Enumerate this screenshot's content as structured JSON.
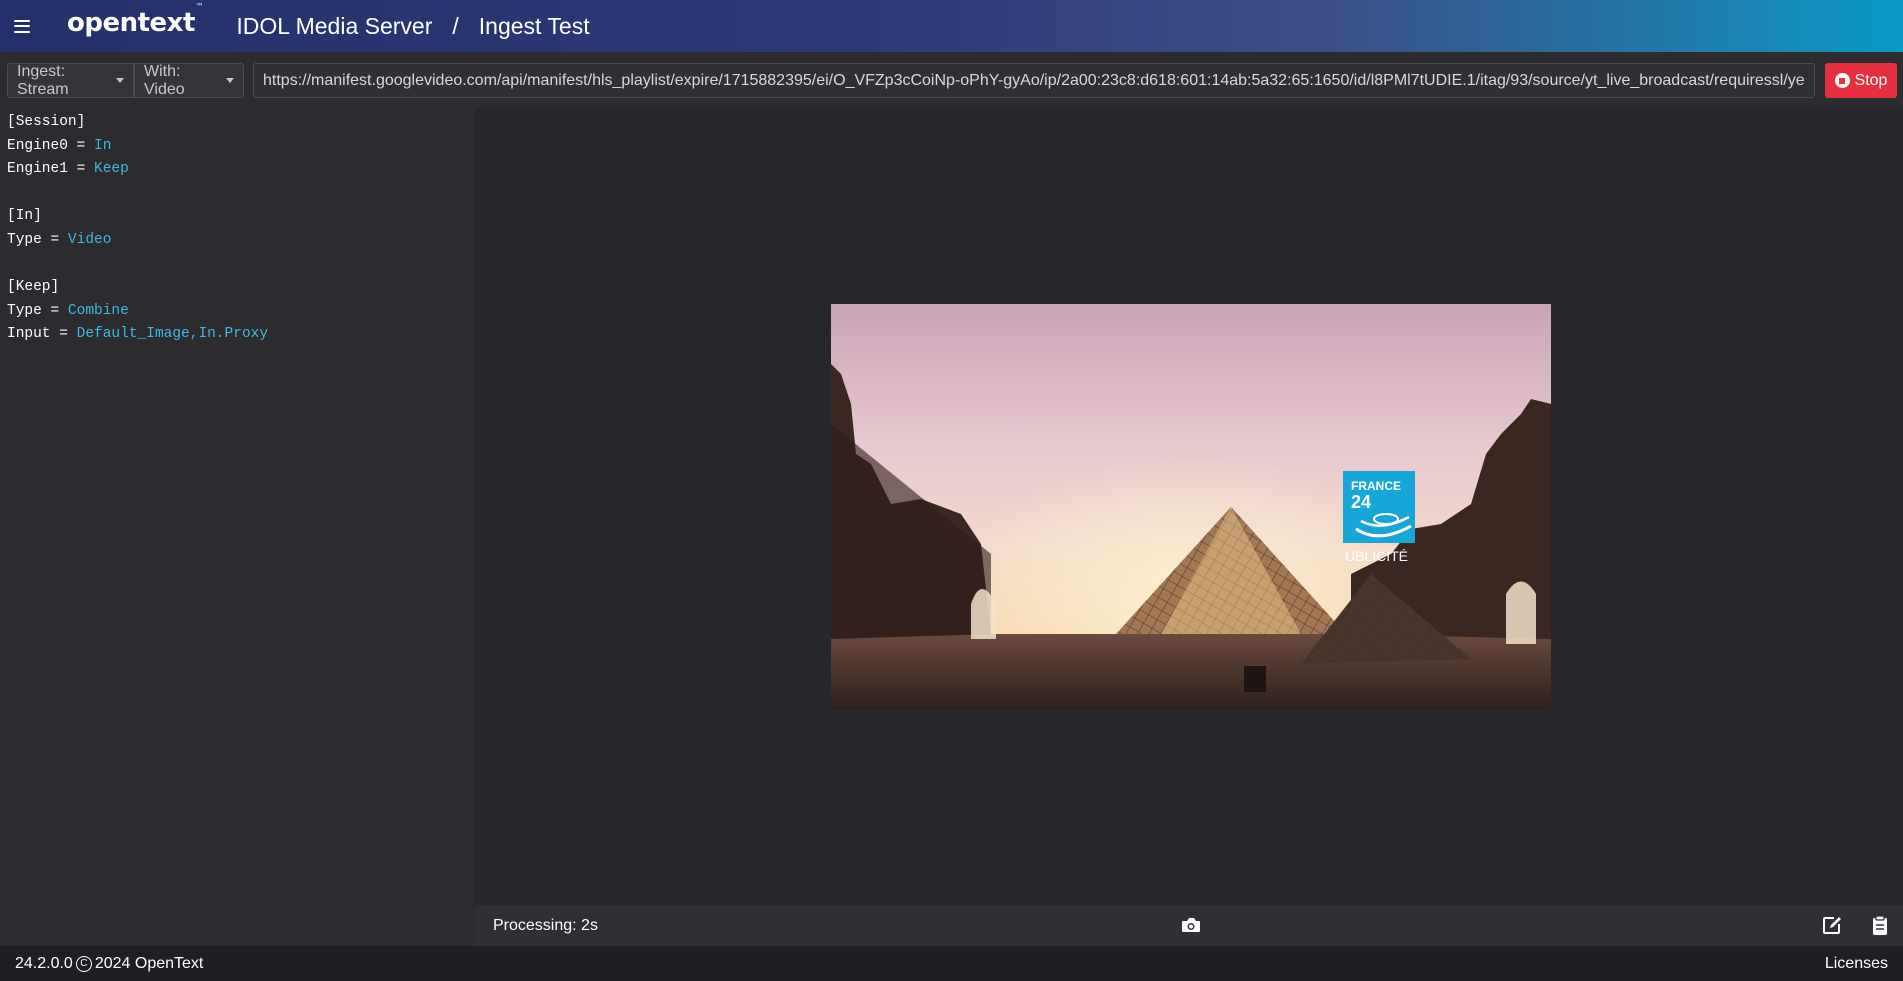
{
  "header": {
    "logo": "opentext",
    "logo_tm": "™",
    "app_title": "IDOL Media Server",
    "separator": "/",
    "page_title": "Ingest Test"
  },
  "toolbar": {
    "ingest_label": "Ingest: Stream",
    "with_label": "With: Video",
    "url_value": "https://manifest.googlevideo.com/api/manifest/hls_playlist/expire/1715882395/ei/O_VFZp3cCoiNp-oPhY-gyAo/ip/2a00:23c8:d618:601:14ab:5a32:65:1650/id/l8PMl7tUDIE.1/itag/93/source/yt_live_broadcast/requiressl/yes/...",
    "stop_label": "Stop",
    "stop_color": "#e5303f"
  },
  "config": {
    "lines": [
      {
        "key": "[Session]",
        "value": ""
      },
      {
        "key": "Engine0 = ",
        "value": "In"
      },
      {
        "key": "Engine1 = ",
        "value": "Keep"
      },
      {
        "key": "",
        "value": ""
      },
      {
        "key": "[In]",
        "value": ""
      },
      {
        "key": "Type = ",
        "value": "Video"
      },
      {
        "key": "",
        "value": ""
      },
      {
        "key": "[Keep]",
        "value": ""
      },
      {
        "key": "Type = ",
        "value": "Combine"
      },
      {
        "key": "Input = ",
        "value": "Default_Image,In.Proxy"
      }
    ],
    "value_color": "#3fb8e0"
  },
  "video": {
    "overlay_brand_line1": "FRANCE",
    "overlay_brand_line2": "24",
    "overlay_caption": "UBLICITÉ"
  },
  "status": {
    "processing": "Processing: 2s",
    "camera_icon": "camera-icon",
    "edit_icon": "edit-icon",
    "clipboard_icon": "clipboard-icon"
  },
  "footer": {
    "version": "24.2.0.0",
    "copyright": "2024 OpenText",
    "licenses": "Licenses"
  }
}
